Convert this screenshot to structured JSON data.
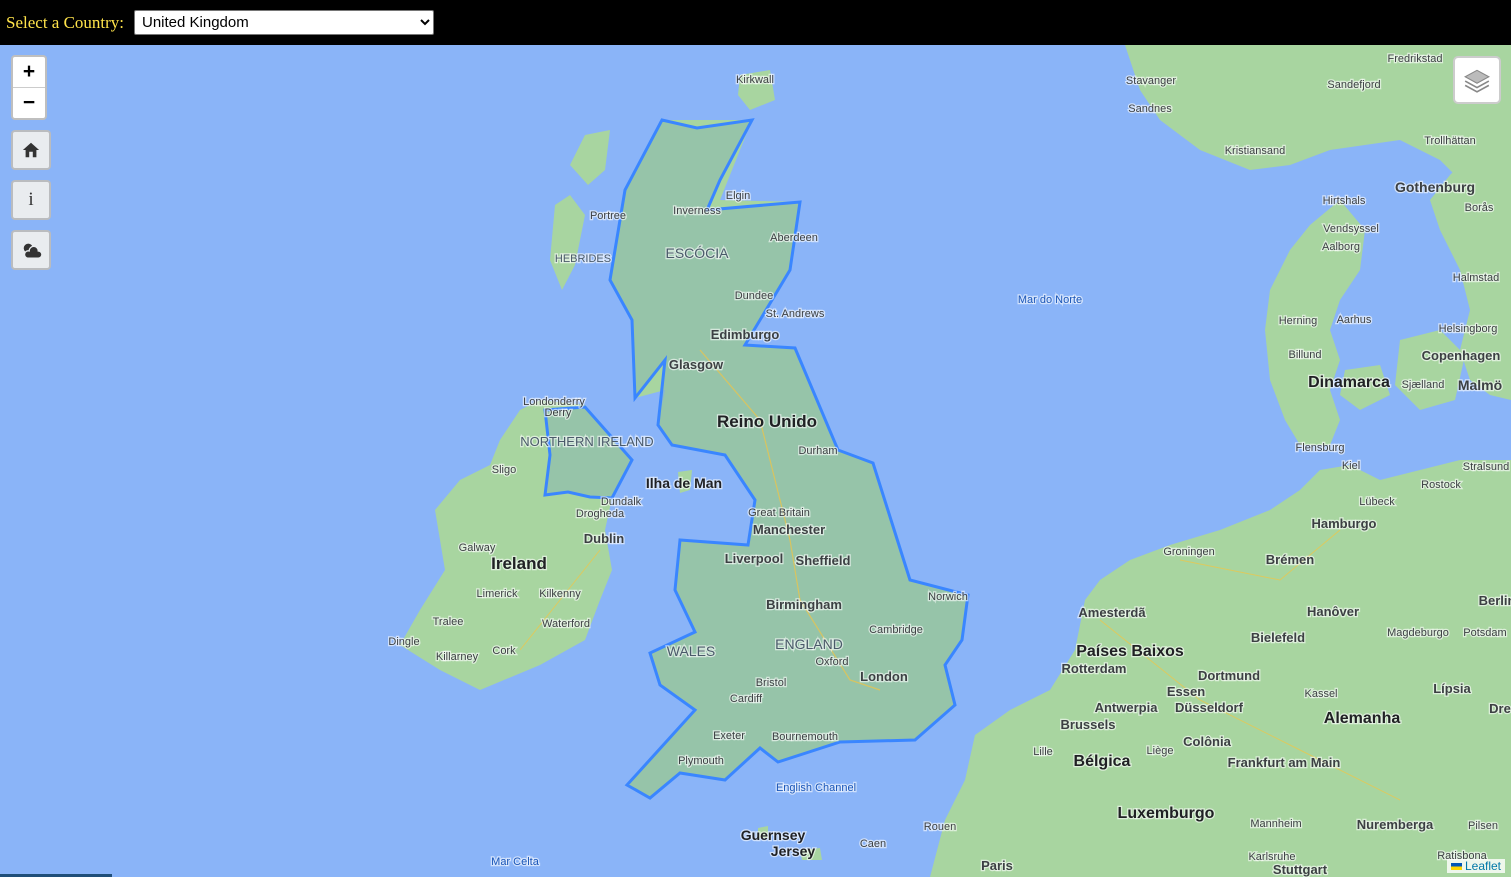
{
  "header": {
    "label": "Select a Country:",
    "selected_country": "United Kingdom"
  },
  "controls": {
    "zoom_in": "+",
    "zoom_out": "−",
    "info": "i"
  },
  "attribution": "Leaflet",
  "colors": {
    "water": "#8ab4f8",
    "land": "#a8d5a0",
    "highlight_stroke": "#3a86ff",
    "highlight_fill": "#86b7b0",
    "header_bg": "#000000",
    "header_label": "#ffe34a"
  },
  "map_labels": {
    "countries": [
      "Reino Unido",
      "Ireland",
      "Dinamarca",
      "Alemanha",
      "Bélgica",
      "Luxemburgo",
      "Países Baixos"
    ],
    "regions": [
      "ESCÓCIA",
      "NORTHERN IRELAND",
      "WALES",
      "ENGLAND",
      "HEBRIDES"
    ],
    "water": [
      "Mar do Norte",
      "Mar Celta",
      "English Channel"
    ],
    "islands": [
      "Ilha de Man",
      "Guernsey",
      "Jersey"
    ],
    "cities": [
      "Kirkwall",
      "Elgin",
      "Inverness",
      "Portree",
      "Aberdeen",
      "Dundee",
      "St. Andrews",
      "Edimburgo",
      "Glasgow",
      "Londonderry",
      "Derry",
      "Sligo",
      "Dundalk",
      "Drogheda",
      "Dublin",
      "Galway",
      "Limerick",
      "Kilkenny",
      "Waterford",
      "Tralee",
      "Dingle",
      "Killarney",
      "Cork",
      "Durham",
      "Great Britain",
      "Manchester",
      "Liverpool",
      "Sheffield",
      "Birmingham",
      "Cambridge",
      "Oxford",
      "London",
      "Norwich",
      "Bristol",
      "Cardiff",
      "Exeter",
      "Bournemouth",
      "Plymouth",
      "Caen",
      "Rouen",
      "Paris",
      "Lille",
      "Brussels",
      "Antwerpia",
      "Rotterdam",
      "Amesterdã",
      "Essen",
      "Düsseldorf",
      "Dortmund",
      "Colônia",
      "Bielefeld",
      "Hanôver",
      "Brémen",
      "Hamburgo",
      "Groningen",
      "Kassel",
      "Frankfurt am Main",
      "Magdeburgo",
      "Potsdam",
      "Berlin",
      "Lípsia",
      "Nuremberga",
      "Mannheim",
      "Karlsruhe",
      "Stuttgart",
      "Pilsen",
      "Ratisbona",
      "Liège",
      "Kiel",
      "Lübeck",
      "Rostock",
      "Stralsund",
      "Flensburg",
      "Herning",
      "Aarhus",
      "Billund",
      "Aalborg",
      "Hirtshals",
      "Vendsyssel",
      "Copenhagen",
      "Helsingborg",
      "Sjælland",
      "Malmö",
      "Halmstad",
      "Borås",
      "Gothenburg",
      "Trollhättan",
      "Fredrikstad",
      "Sandefjord",
      "Kristiansand",
      "Stavanger",
      "Sandnes",
      "Dre"
    ]
  }
}
